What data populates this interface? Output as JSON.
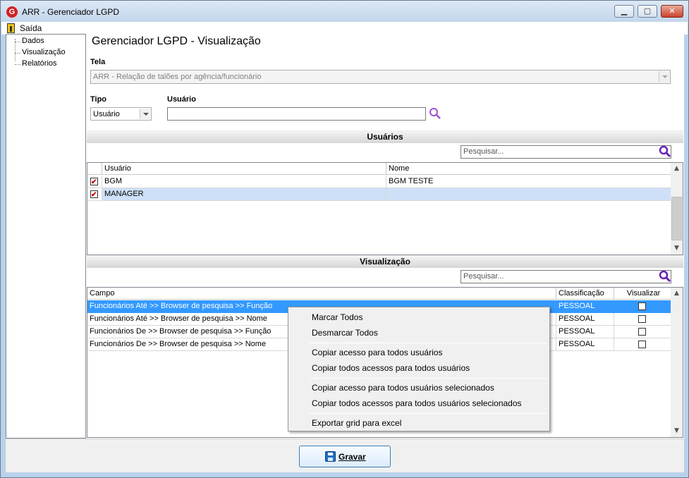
{
  "window": {
    "title": "ARR - Gerenciador LGPD",
    "logo_letter": "G"
  },
  "menu": {
    "exit_label": "Saída"
  },
  "sidebar": {
    "items": [
      "Dados",
      "Visualização",
      "Relatórios"
    ]
  },
  "page": {
    "title": "Gerenciador LGPD - Visualização"
  },
  "tela": {
    "label": "Tela",
    "value": "ARR - Relação de talões por agência/funcionário"
  },
  "tipo": {
    "label": "Tipo",
    "value": "Usuário"
  },
  "usuario_field": {
    "label": "Usuário",
    "value": ""
  },
  "usuarios_section": {
    "title": "Usuários",
    "search_placeholder": "Pesquisar...",
    "columns": [
      "Usuário",
      "Nome"
    ],
    "rows": [
      {
        "usuario": "BGM",
        "nome": "BGM TESTE",
        "checked": true
      },
      {
        "usuario": "MANAGER",
        "nome": "",
        "checked": true
      }
    ]
  },
  "visualizacao_section": {
    "title": "Visualização",
    "search_placeholder": "Pesquisar...",
    "columns": [
      "Campo",
      "Classificação",
      "Visualizar"
    ],
    "rows": [
      {
        "campo": "Funcionários Até >> Browser de pesquisa >> Função",
        "classificacao": "PESSOAL",
        "visualizar": false
      },
      {
        "campo": "Funcionários Até >> Browser de pesquisa >> Nome",
        "classificacao": "PESSOAL",
        "visualizar": false
      },
      {
        "campo": "Funcionários De >> Browser de pesquisa >> Função",
        "classificacao": "PESSOAL",
        "visualizar": false
      },
      {
        "campo": "Funcionários De >> Browser de pesquisa >> Nome",
        "classificacao": "PESSOAL",
        "visualizar": false
      }
    ]
  },
  "context_menu": {
    "items": [
      "Marcar Todos",
      "Desmarcar Todos",
      "Copiar acesso para todos usuários",
      "Copiar todos acessos para todos usuários",
      "Copiar acesso para todos usuários selecionados",
      "Copiar todos acessos para todos usuários selecionados",
      "Exportar grid para excel"
    ]
  },
  "footer": {
    "save_label": "Gravar"
  },
  "colors": {
    "selection": "#3399ff",
    "selection_light": "#cde0f7",
    "accent": "#7a2fc6"
  }
}
